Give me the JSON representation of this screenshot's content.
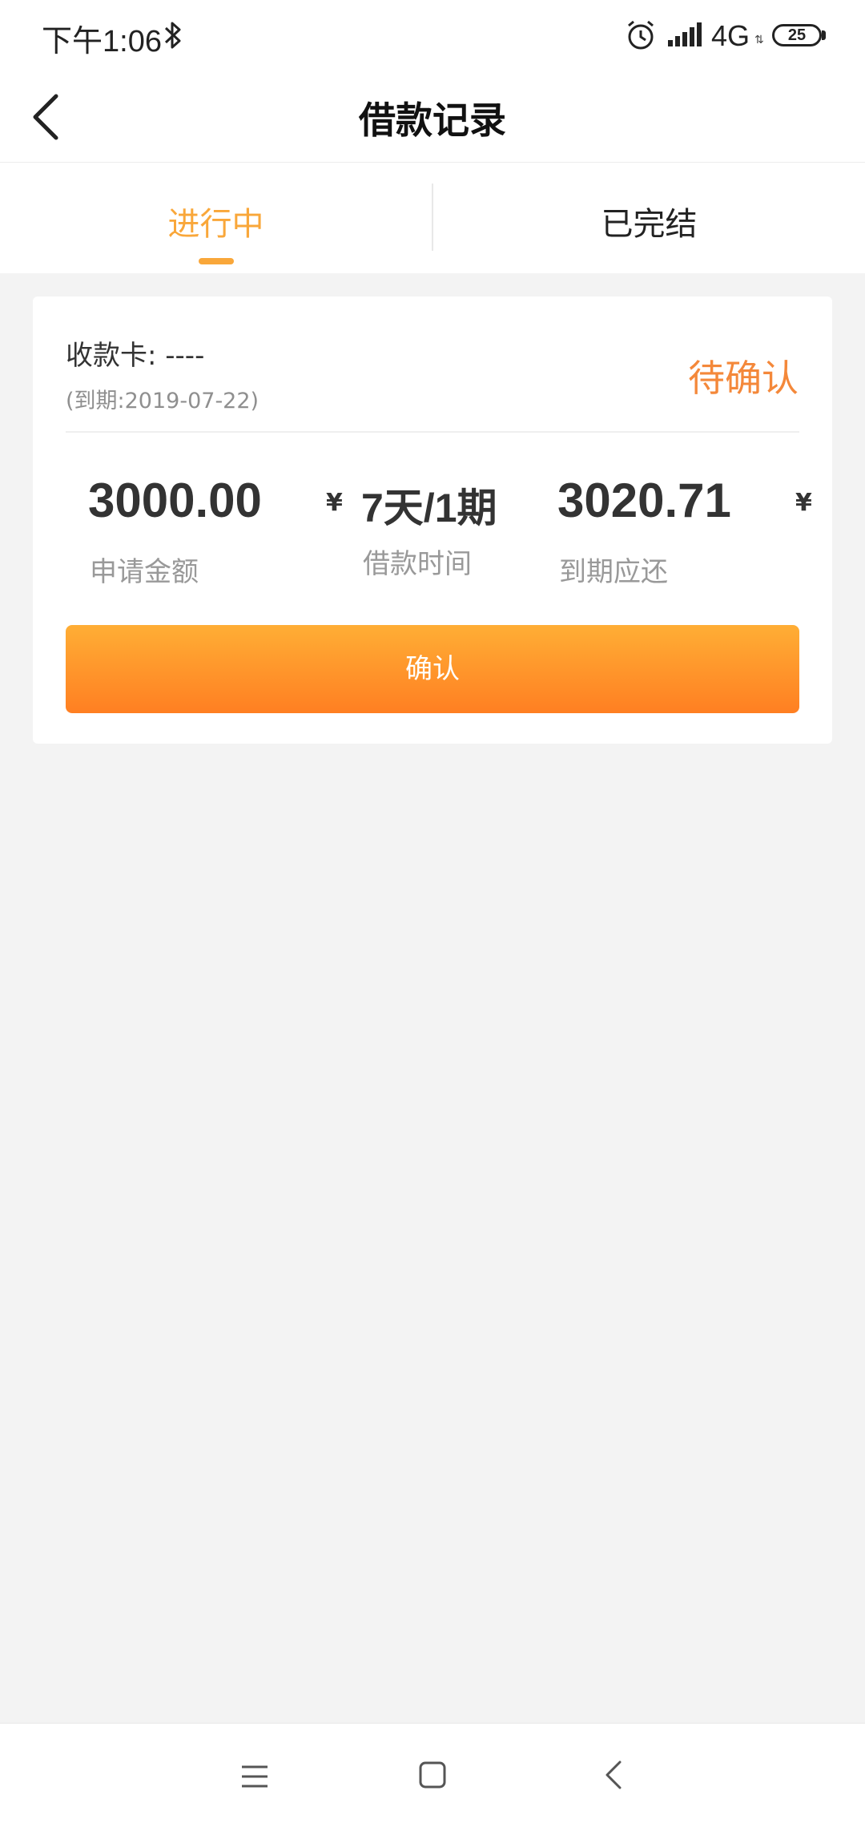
{
  "status_bar": {
    "time": "下午1:06",
    "network": "4G",
    "battery": "25"
  },
  "header": {
    "title": "借款记录"
  },
  "tabs": [
    {
      "label": "进行中",
      "active": true
    },
    {
      "label": "已完结",
      "active": false
    }
  ],
  "loan": {
    "account_label": "收款卡: ----",
    "due_date": "(到期:2019-07-22)",
    "status": "待确认",
    "amount": {
      "value": "3000.00",
      "unit": "¥",
      "label": "申请金额"
    },
    "period": {
      "value": "7天/1期",
      "label": "借款时间"
    },
    "repayment": {
      "value": "3020.71",
      "unit": "¥",
      "label": "到期应还"
    },
    "confirm_label": "确认"
  },
  "colors": {
    "accent": "#f9a73a",
    "status": "#f4883a",
    "button_top": "#ffae35",
    "button_bottom": "#ff7f22"
  }
}
